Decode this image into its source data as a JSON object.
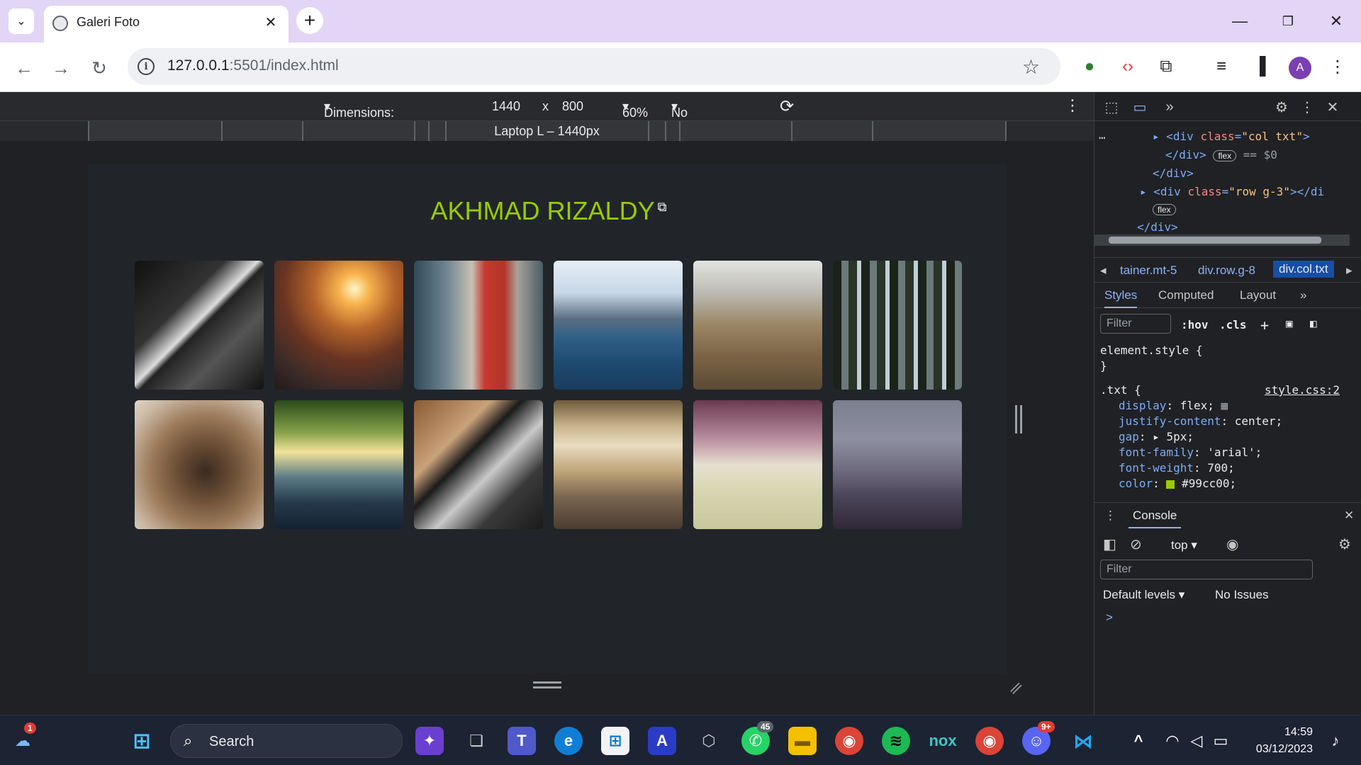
{
  "tab": {
    "title": "Galeri Foto"
  },
  "toolbar": {
    "url_host": "127.0.0.1",
    "url_path": ":5501/index.html"
  },
  "avatar": {
    "letter": "A"
  },
  "device_toolbar": {
    "dimensions": "Dimensions: Responsive",
    "width": "1440",
    "times": "x",
    "height": "800",
    "zoom": "60%",
    "throttling": "No throttling",
    "media_query_label": "Laptop L – 1440px"
  },
  "page": {
    "title": "AKHMAD RIZALDY",
    "title_color": "#99cc00",
    "background": "#212529",
    "photos": [
      {
        "name": "photo-building"
      },
      {
        "name": "photo-sunset-traffic"
      },
      {
        "name": "photo-red-postbox"
      },
      {
        "name": "photo-man-lake"
      },
      {
        "name": "photo-mountain-forest"
      },
      {
        "name": "photo-tall-trees"
      },
      {
        "name": "photo-bear"
      },
      {
        "name": "photo-forest-road"
      },
      {
        "name": "photo-laptop"
      },
      {
        "name": "photo-grand-central"
      },
      {
        "name": "photo-pink-forest"
      },
      {
        "name": "photo-misty-sea"
      }
    ]
  },
  "devtools": {
    "tree": {
      "line1_tag_open": "<div ",
      "line1_attr": "class",
      "line1_val": "\"col txt\"",
      "line1_close": ">",
      "line2": "</div>",
      "flex_pill": "flex",
      "line2_suffix": "== $0",
      "line3": "</div>",
      "line4_tag_open": "<div ",
      "line4_attr": "class",
      "line4_val": "\"row g-3\"",
      "line4_close": "></di",
      "line6": "</div>"
    },
    "breadcrumbs": [
      "tainer.mt-5",
      "div.row.g-8",
      "div.col.txt"
    ],
    "styles_tabs": [
      "Styles",
      "Computed",
      "Layout"
    ],
    "filter_placeholder": "Filter",
    "hov": ":hov",
    "cls": ".cls",
    "element_style": "element.style {",
    "close_brace": "}",
    "rule_selector": ".txt {",
    "rule_source": "style.css:2",
    "declarations": [
      {
        "prop": "display",
        "value": "flex;"
      },
      {
        "prop": "justify-content",
        "value": "center;"
      },
      {
        "prop": "gap",
        "value": "5px;"
      },
      {
        "prop": "font-family",
        "value": "'arial';"
      },
      {
        "prop": "font-weight",
        "value": "700;"
      },
      {
        "prop": "color",
        "value": "#99cc00;"
      }
    ],
    "console": {
      "tab": "Console",
      "context": "top",
      "filter_placeholder": "Filter",
      "levels": "Default levels",
      "issues": "No Issues",
      "prompt": ">"
    }
  },
  "taskbar": {
    "search_label": "Search",
    "weather_badge": "1",
    "whatsapp_badge": "45",
    "discord_badge": "9+",
    "time": "14:59",
    "date": "03/12/2023"
  }
}
